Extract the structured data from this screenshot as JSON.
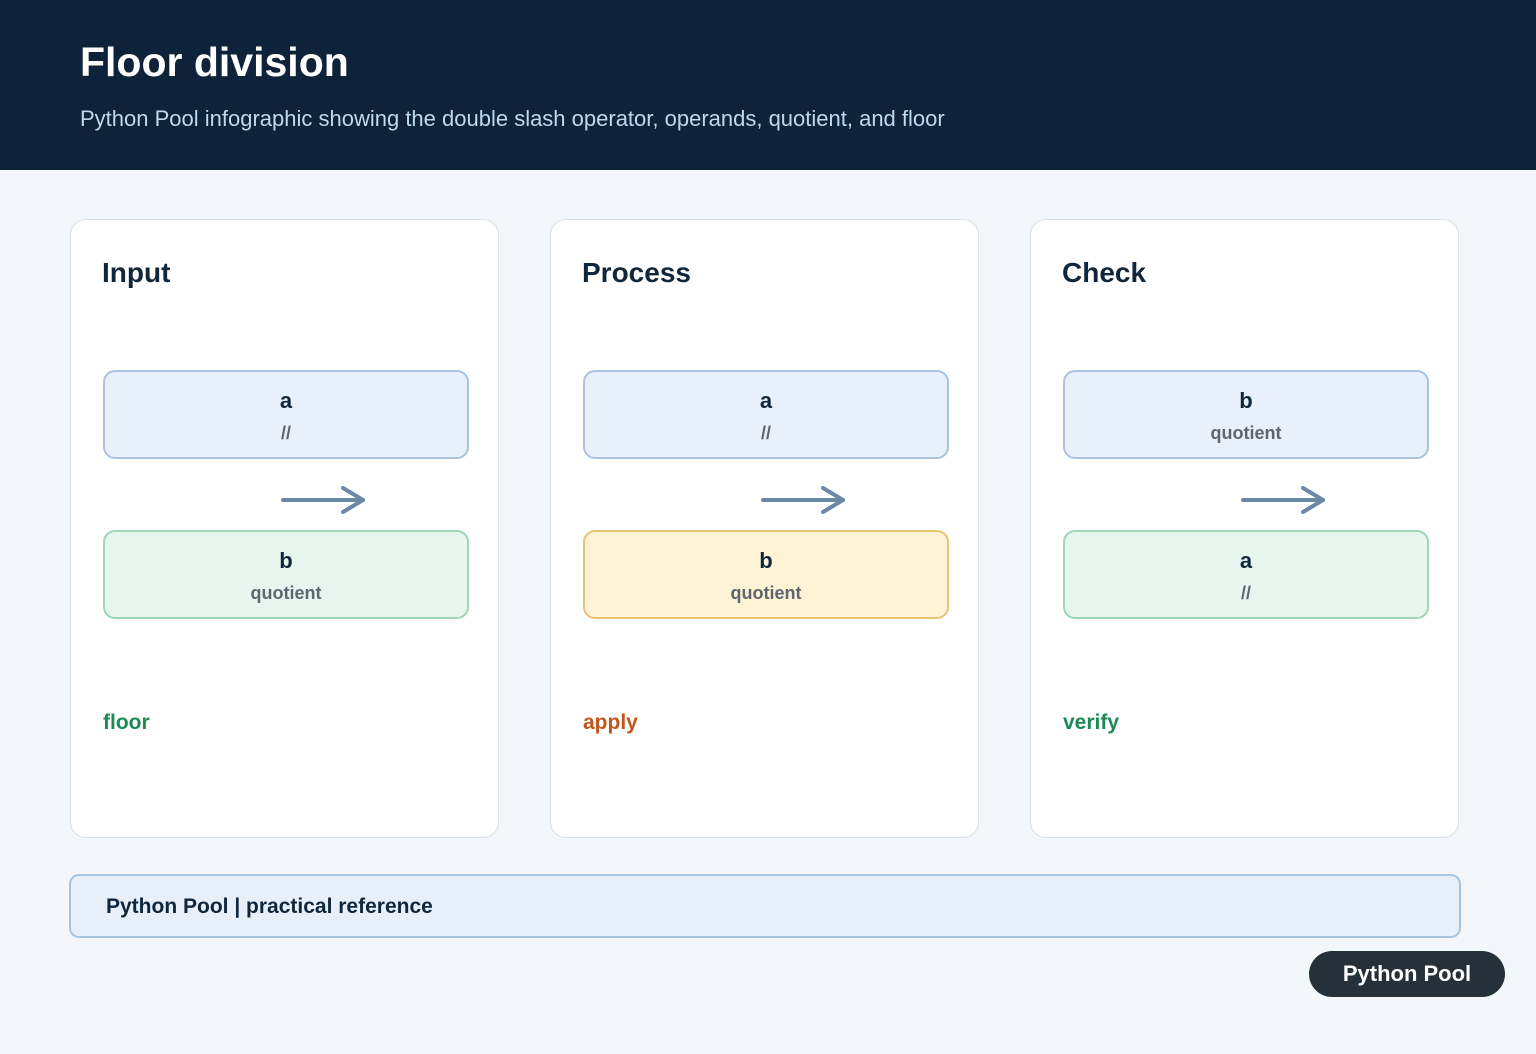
{
  "header": {
    "title": "Floor division",
    "subtitle": "Python Pool infographic showing the double slash operator, operands, quotient, and floor"
  },
  "colors": {
    "header_bg": "#0e233a",
    "blue_box": "#e7f0fb",
    "green_box": "#e6f6ee",
    "yellow_box": "#fff3d6",
    "arrow": "#6a89a7",
    "tag_green": "#1c8a55",
    "tag_orange": "#c0571b"
  },
  "cards": [
    {
      "title": "Input",
      "top_box": {
        "main": "a",
        "sub": "//"
      },
      "bottom_box": {
        "main": "b",
        "sub": "quotient"
      },
      "tag": "floor"
    },
    {
      "title": "Process",
      "top_box": {
        "main": "a",
        "sub": "//"
      },
      "bottom_box": {
        "main": "b",
        "sub": "quotient"
      },
      "tag": "apply"
    },
    {
      "title": "Check",
      "top_box": {
        "main": "b",
        "sub": "quotient"
      },
      "bottom_box": {
        "main": "a",
        "sub": "//"
      },
      "tag": "verify"
    }
  ],
  "footer": {
    "text": "Python Pool | practical reference"
  },
  "badge": {
    "label": "Python Pool"
  }
}
